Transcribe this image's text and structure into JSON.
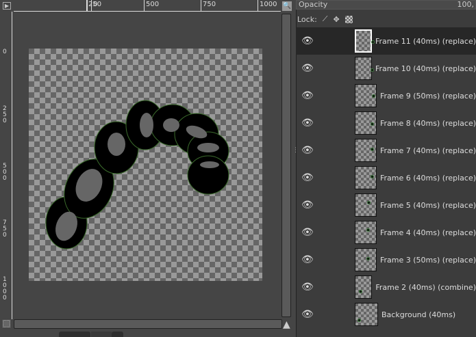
{
  "ruler": {
    "top_labels": [
      "0",
      "250",
      "500",
      "750",
      "1000"
    ],
    "left_labels": [
      "0",
      "250",
      "500",
      "750",
      "1000"
    ]
  },
  "layers_panel": {
    "opacity_label": "Opacity",
    "opacity_value": "100,",
    "lock_label": "Lock:"
  },
  "layers": [
    {
      "name": "Frame 11 (40ms) (replace)",
      "selected": true
    },
    {
      "name": "Frame 10 (40ms) (replace)"
    },
    {
      "name": "Frame 9 (50ms) (replace)"
    },
    {
      "name": "Frame 8 (40ms) (replace)"
    },
    {
      "name": "Frame 7 (40ms) (replace)"
    },
    {
      "name": "Frame 6 (40ms) (replace)"
    },
    {
      "name": "Frame 5 (40ms) (replace)"
    },
    {
      "name": "Frame 4 (40ms) (replace)"
    },
    {
      "name": "Frame 3 (50ms) (replace)"
    },
    {
      "name": "Frame 2 (40ms) (combine)"
    },
    {
      "name": "Background (40ms)"
    }
  ]
}
